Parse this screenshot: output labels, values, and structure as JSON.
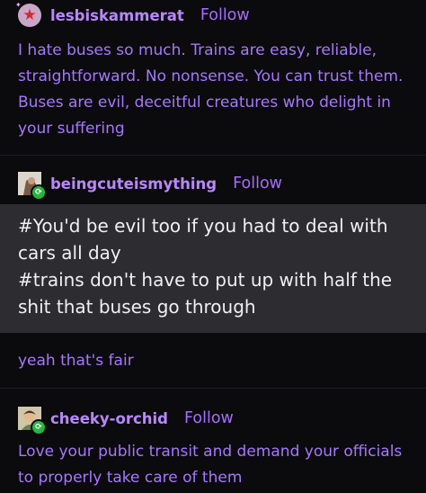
{
  "posts": [
    {
      "username": "lesbiskammerat",
      "follow_label": "Follow",
      "text": "I hate buses so much. Trains are easy, reliable, straightforward. No nonsense. You can trust them. Buses are evil, deceitful creatures who delight in your suffering",
      "avatar_icon": "star-avatar"
    },
    {
      "username": "beingcuteismything",
      "follow_label": "Follow",
      "tags": [
        "#You'd be evil too if you had to deal with cars all day",
        "#trains don't have to put up with half the shit that buses go through"
      ],
      "text": "yeah that's fair",
      "avatar_icon": "photo-avatar",
      "badge_icon": "reblog-icon"
    },
    {
      "username": "cheeky-orchid",
      "follow_label": "Follow",
      "text": "Love your public transit and demand your officials to properly take care of them",
      "avatar_icon": "photo-avatar",
      "badge_icon": "reblog-icon"
    }
  ],
  "colors": {
    "background": "#0b0a0c",
    "username": "#b988ff",
    "follow": "#a66cff",
    "body_text": "#a777ff",
    "tag_box": "#2d2c31",
    "tag_text": "#f0eff2",
    "badge": "#27b53e"
  }
}
